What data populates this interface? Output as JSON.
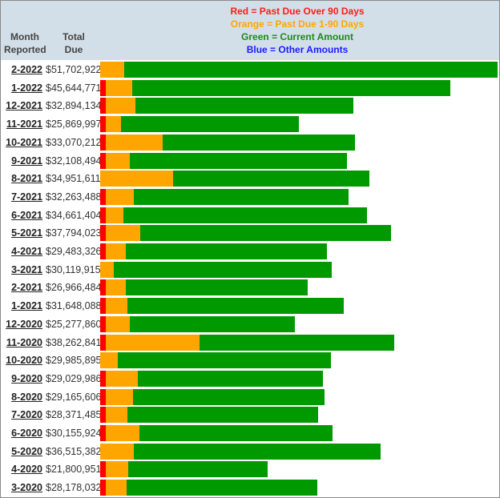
{
  "header": {
    "month_label_1": "Month",
    "month_label_2": "Reported",
    "total_label_1": "Total",
    "total_label_2": "Due"
  },
  "legend": [
    {
      "text": "Red = Past Due Over 90 Days",
      "color": "#ff1a1a"
    },
    {
      "text": "Orange = Past Due 1-90 Days",
      "color": "#ffa500"
    },
    {
      "text": "Green = Current Amount",
      "color": "#1a8a1a"
    },
    {
      "text": "Blue = Other Amounts",
      "color": "#1a1aff"
    }
  ],
  "colors": {
    "red": "#ff0000",
    "orange": "#ffa500",
    "green": "#009900",
    "blue": "#0000ff"
  },
  "chart_data": {
    "type": "bar",
    "orientation": "horizontal",
    "stacked": true,
    "title": "",
    "xlabel": "",
    "ylabel": "Month Reported",
    "units": "USD millions",
    "categories": [
      "2-2022",
      "1-2022",
      "12-2021",
      "11-2021",
      "10-2021",
      "9-2021",
      "8-2021",
      "7-2021",
      "6-2021",
      "5-2021",
      "4-2021",
      "3-2021",
      "2-2021",
      "1-2021",
      "12-2020",
      "11-2020",
      "10-2020",
      "9-2020",
      "8-2020",
      "7-2020",
      "6-2020",
      "5-2020",
      "4-2020",
      "3-2020"
    ],
    "totals": [
      "$51,702,922",
      "$45,644,771",
      "$32,894,134",
      "$25,869,997",
      "$33,070,212",
      "$32,108,494",
      "$34,951,611",
      "$32,263,488",
      "$34,661,404",
      "$37,794,023",
      "$29,483,326",
      "$30,119,915",
      "$26,966,484",
      "$31,648,088",
      "$25,277,860",
      "$38,262,841",
      "$29,985,895",
      "$29,029,986",
      "$29,165,606",
      "$28,371,485",
      "$30,155,924",
      "$36,515,382",
      "$21,800,951",
      "$28,178,032"
    ],
    "series": [
      {
        "name": "Past Due Over 90 Days",
        "color": "#ff0000",
        "values": [
          0.0,
          0.7,
          0.7,
          0.7,
          0.7,
          0.7,
          0.0,
          0.7,
          0.7,
          0.7,
          0.7,
          0.0,
          0.7,
          0.7,
          0.7,
          0.7,
          0.0,
          0.7,
          0.7,
          0.7,
          0.7,
          0.0,
          0.7,
          0.7
        ]
      },
      {
        "name": "Past Due 1-90 Days",
        "color": "#ffa500",
        "values": [
          3.1,
          3.5,
          3.9,
          2.0,
          7.4,
          3.2,
          9.5,
          3.7,
          2.3,
          4.5,
          2.6,
          1.8,
          2.6,
          2.8,
          3.2,
          12.2,
          2.3,
          4.2,
          3.6,
          2.8,
          4.4,
          4.4,
          3.0,
          2.7
        ]
      },
      {
        "name": "Current Amount",
        "color": "#009900",
        "values": [
          48.6,
          41.4,
          28.3,
          23.2,
          25.0,
          28.2,
          25.5,
          27.9,
          31.7,
          32.6,
          26.2,
          28.3,
          23.7,
          28.2,
          21.4,
          25.4,
          27.7,
          24.1,
          24.9,
          24.9,
          25.1,
          32.1,
          18.1,
          24.8
        ]
      },
      {
        "name": "Other Amounts",
        "color": "#0000ff",
        "values": [
          0,
          0,
          0,
          0,
          0,
          0,
          0,
          0,
          0,
          0,
          0,
          0,
          0,
          0,
          0,
          0,
          0,
          0,
          0,
          0,
          0,
          0,
          0,
          0
        ]
      }
    ],
    "xlim": [
      0,
      51.7
    ],
    "grid": false,
    "legend_position": "top-center"
  }
}
